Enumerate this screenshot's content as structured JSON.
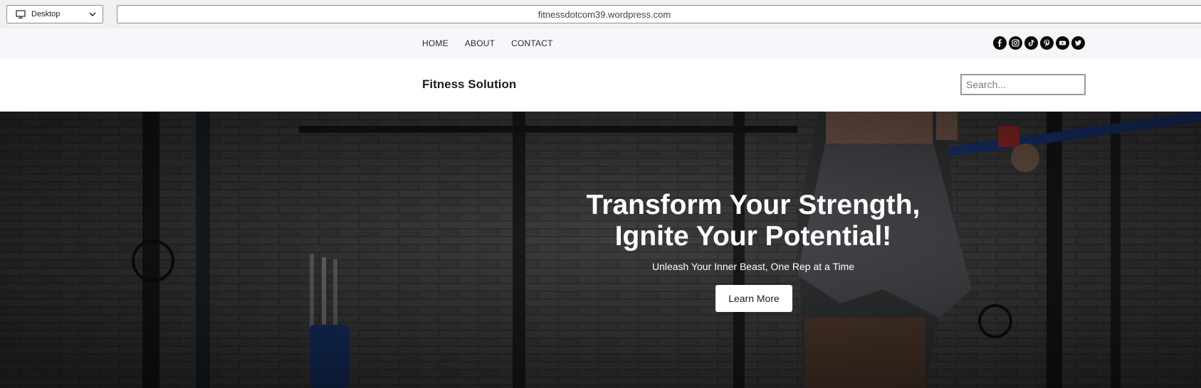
{
  "toolbar": {
    "device_label": "Desktop",
    "url": "fitnessdotcom39.wordpress.com"
  },
  "nav": {
    "items": [
      "HOME",
      "ABOUT",
      "CONTACT"
    ]
  },
  "social_icons": [
    "facebook-icon",
    "instagram-icon",
    "tiktok-icon",
    "pinterest-icon",
    "youtube-icon",
    "twitter-icon"
  ],
  "header": {
    "site_title": "Fitness Solution",
    "search_placeholder": "Search..."
  },
  "hero": {
    "title_line1": "Transform Your Strength,",
    "title_line2": "Ignite Your Potential!",
    "subtitle": "Unleash Your Inner Beast, One Rep at a Time",
    "cta_label": "Learn More"
  },
  "colors": {
    "nav_bg": "#f6f7fa",
    "social_icon_bg": "#0a0a0a",
    "hero_text": "#ffffff"
  }
}
